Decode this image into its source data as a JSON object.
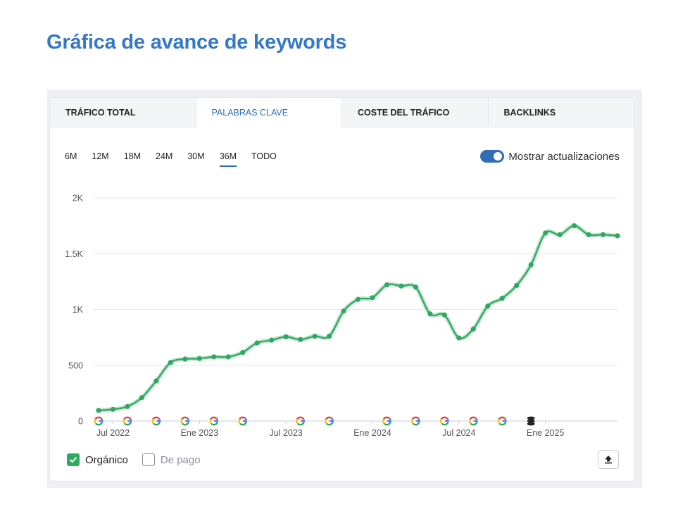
{
  "page": {
    "title": "Gráfica de avance de keywords"
  },
  "tabs": [
    {
      "label": "TRÁFICO TOTAL",
      "active": false
    },
    {
      "label": "PALABRAS CLAVE",
      "active": true
    },
    {
      "label": "COSTE DEL TRÁFICO",
      "active": false
    },
    {
      "label": "BACKLINKS",
      "active": false
    }
  ],
  "periods": [
    {
      "label": "6M",
      "active": false
    },
    {
      "label": "12M",
      "active": false
    },
    {
      "label": "18M",
      "active": false
    },
    {
      "label": "24M",
      "active": false
    },
    {
      "label": "30M",
      "active": false
    },
    {
      "label": "36M",
      "active": true
    },
    {
      "label": "TODO",
      "active": false
    }
  ],
  "toggle": {
    "label": "Mostrar actualizaciones",
    "on": true
  },
  "legend": [
    {
      "label": "Orgánico",
      "checked": true
    },
    {
      "label": "De pago",
      "checked": false
    }
  ],
  "colors": {
    "accent": "#2f6db5",
    "title": "#3478c6",
    "series": "#2fa860",
    "grid": "#e3e6ec"
  },
  "chart_data": {
    "type": "line",
    "title": "",
    "xlabel": "",
    "ylabel": "",
    "grid": true,
    "legend_position": "bottom-left",
    "ylim": [
      0,
      2000
    ],
    "y_ticks": [
      0,
      500,
      1000,
      1500,
      2000
    ],
    "y_tick_labels": [
      "0",
      "500",
      "1K",
      "1.5K",
      "2K"
    ],
    "x_tick_labels": [
      "Jul 2022",
      "Ene 2023",
      "Jul 2023",
      "Ene 2024",
      "Jul 2024",
      "Ene 2025"
    ],
    "x_tick_months": [
      1,
      7,
      13,
      19,
      25,
      31
    ],
    "x_range_months": [
      0,
      36
    ],
    "series": [
      {
        "name": "Orgánico",
        "color": "#2fa860",
        "x_months": [
          0,
          1,
          2,
          3,
          4,
          5,
          6,
          7,
          8,
          9,
          10,
          11,
          12,
          13,
          14,
          15,
          16,
          17,
          18,
          19,
          20,
          21,
          22,
          23,
          24,
          25,
          26,
          27,
          28,
          29,
          30,
          31,
          32,
          33,
          34,
          35,
          36
        ],
        "values": [
          95,
          105,
          130,
          210,
          360,
          525,
          555,
          560,
          575,
          575,
          615,
          700,
          725,
          755,
          730,
          760,
          760,
          985,
          1090,
          1105,
          1220,
          1210,
          1200,
          960,
          950,
          745,
          825,
          1030,
          1100,
          1215,
          1400,
          1685,
          1670,
          1750,
          1670,
          1670,
          1660
        ]
      }
    ],
    "update_markers": [
      {
        "month": 0,
        "icon": "google-icon"
      },
      {
        "month": 2,
        "icon": "google-icon"
      },
      {
        "month": 4,
        "icon": "google-icon"
      },
      {
        "month": 6,
        "icon": "google-icon"
      },
      {
        "month": 8,
        "icon": "google-icon"
      },
      {
        "month": 10,
        "icon": "google-icon"
      },
      {
        "month": 14,
        "icon": "google-icon"
      },
      {
        "month": 16,
        "icon": "google-icon"
      },
      {
        "month": 20,
        "icon": "google-icon"
      },
      {
        "month": 22,
        "icon": "google-icon"
      },
      {
        "month": 24,
        "icon": "google-icon"
      },
      {
        "month": 26,
        "icon": "google-icon"
      },
      {
        "month": 28,
        "icon": "google-icon"
      },
      {
        "month": 30,
        "icon": "database-icon"
      }
    ]
  }
}
